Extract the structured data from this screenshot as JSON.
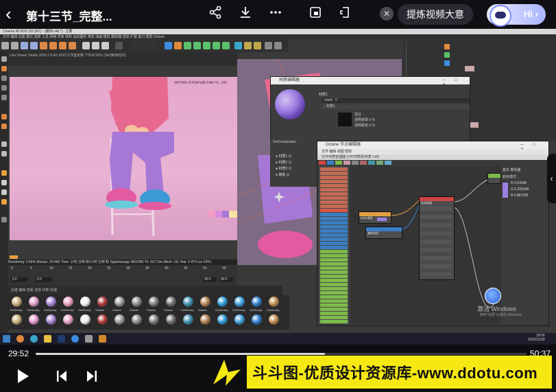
{
  "player": {
    "title": "第十三节_完整...",
    "ai_summary_label": "提炼视频大意",
    "assistant_label": "Hi",
    "current_time": "29:52",
    "total_time": "50:37",
    "progress_fraction": 0.59,
    "icons": [
      "back-icon",
      "share-icon",
      "download-icon",
      "more-icon",
      "picture-in-picture-icon",
      "float-window-icon",
      "close-icon",
      "play-icon",
      "previous-icon",
      "next-icon"
    ]
  },
  "c4d": {
    "window_title": "Cinema 4D R23.110 (RC) - [服饰.c4d *] - 主要",
    "menu": "文件  编辑  创建  模式  选择  工具  网格  样条  体积  运动图形  角色  动画  模拟  跟踪器  渲染  扩展  窗口  帮助  Octane",
    "live_viewer_title": "Live Viewer Studio 2020.2.5-R3  K921工作室定制  TTK921001  (36H剩余时间)",
    "render_info": "990*896  ZOOM:%80  FAR:76...165",
    "status_bar": "Rendering: 0.65%  Ms/sec: 20.466  Time: 小时 分钟 秒/小时 分钟 秒  Spp/maxspp: 86/1000  Tri: 0/17.5m  Mesh: 111  Hair: 0  RTX:on  GPU:",
    "timeline_ticks": [
      "0",
      "5",
      "10",
      "15",
      "20",
      "25",
      "30",
      "35",
      "40",
      "45",
      "50",
      "55"
    ],
    "timeline_frames": {
      "start": "0 F",
      "current": "0 F",
      "end": "90 F",
      "max": "90 F"
    },
    "material_menu": "创建  编辑  查看  选择  材质  纹理",
    "materials": [
      {
        "label": "OctGlossy",
        "color": "#c9b07a"
      },
      {
        "label": "OctGlossy",
        "color": "#e39acb"
      },
      {
        "label": "OctGlossy",
        "color": "#a884d6"
      },
      {
        "label": "OctGlossy",
        "color": "#e8a0c0"
      },
      {
        "label": "OctGlossy",
        "color": "#eeeeee"
      },
      {
        "label": "Octane",
        "color": "#b03a3a"
      },
      {
        "label": "Octane",
        "color": "#9a9a9a"
      },
      {
        "label": "Octane",
        "color": "#8a8a8a"
      },
      {
        "label": "Octane",
        "color": "#7d7d7d"
      },
      {
        "label": "Octane",
        "color": "#6f6f6f"
      },
      {
        "label": "OctGlossy",
        "color": "#3f8fb0"
      },
      {
        "label": "Octane",
        "color": "#b08050"
      },
      {
        "label": "OctGlossy",
        "color": "#2e9ad6"
      },
      {
        "label": "OctGlossy",
        "color": "#3fa0e0"
      },
      {
        "label": "OctGlossy",
        "color": "#2e7fd0"
      },
      {
        "label": "OctGlossy",
        "color": "#c08a50"
      }
    ]
  },
  "material_editor": {
    "title": "材质编辑器",
    "name": "材质1",
    "mask_label": "mask",
    "mask_value": "0",
    "layer_label": "· 材质1",
    "field_1": "混合",
    "field_2": "透明遮罩 0 %",
    "field_3": "透明颜色 0 %",
    "node_name": "OctComposite1",
    "layers": [
      "材质1",
      "材质2",
      "材质3",
      "模板"
    ]
  },
  "octane_node_editor": {
    "title": "Octane 节点编辑器",
    "menu": "文件  编辑  视图  帮助",
    "sub": "打开材质管理器   打开材质球/材质   C4D",
    "right_header": "基本  着色器",
    "right_section": "颜色模式",
    "color_values": [
      {
        "label": "R",
        "value": "0.53948"
      },
      {
        "label": "G",
        "value": "0.282348"
      },
      {
        "label": "B",
        "value": "0.887925"
      }
    ],
    "node_labels": [
      "RGB 颜色",
      "漫射材质",
      "合成纹理",
      "多层材质"
    ],
    "list_colors": [
      "#c46b55",
      "#c46b55",
      "#c46b55",
      "#c46b55",
      "#c46b55",
      "#c46b55",
      "#c46b55",
      "#c46b55",
      "#c46b55",
      "#c46b55",
      "#d9564a",
      "#3a7fc4",
      "#3a7fc4",
      "#3a7fc4",
      "#3a7fc4",
      "#3a7fc4",
      "#3a7fc4",
      "#3a7fc4",
      "#3a7fc4",
      "#3a7fc4",
      "#7dbb4a",
      "#7dbb4a",
      "#7dbb4a",
      "#7dbb4a",
      "#7dbb4a",
      "#7dbb4a",
      "#7dbb4a",
      "#7dbb4a",
      "#7dbb4a",
      "#7dbb4a",
      "#7dbb4a",
      "#7dbb4a",
      "#7dbb4a",
      "#7dbb4a",
      "#7dbb4a",
      "#7dbb4a",
      "#7dbb4a",
      "#7dbb4a"
    ]
  },
  "windows": {
    "activation_title": "激活 Windows",
    "activation_sub": "转到\"设置\"以激活 Windows。",
    "clock": "18:05",
    "date": "2022/11/30"
  },
  "banner": {
    "text": "斗斗图-优质设计资源库-www.ddotu.com"
  }
}
